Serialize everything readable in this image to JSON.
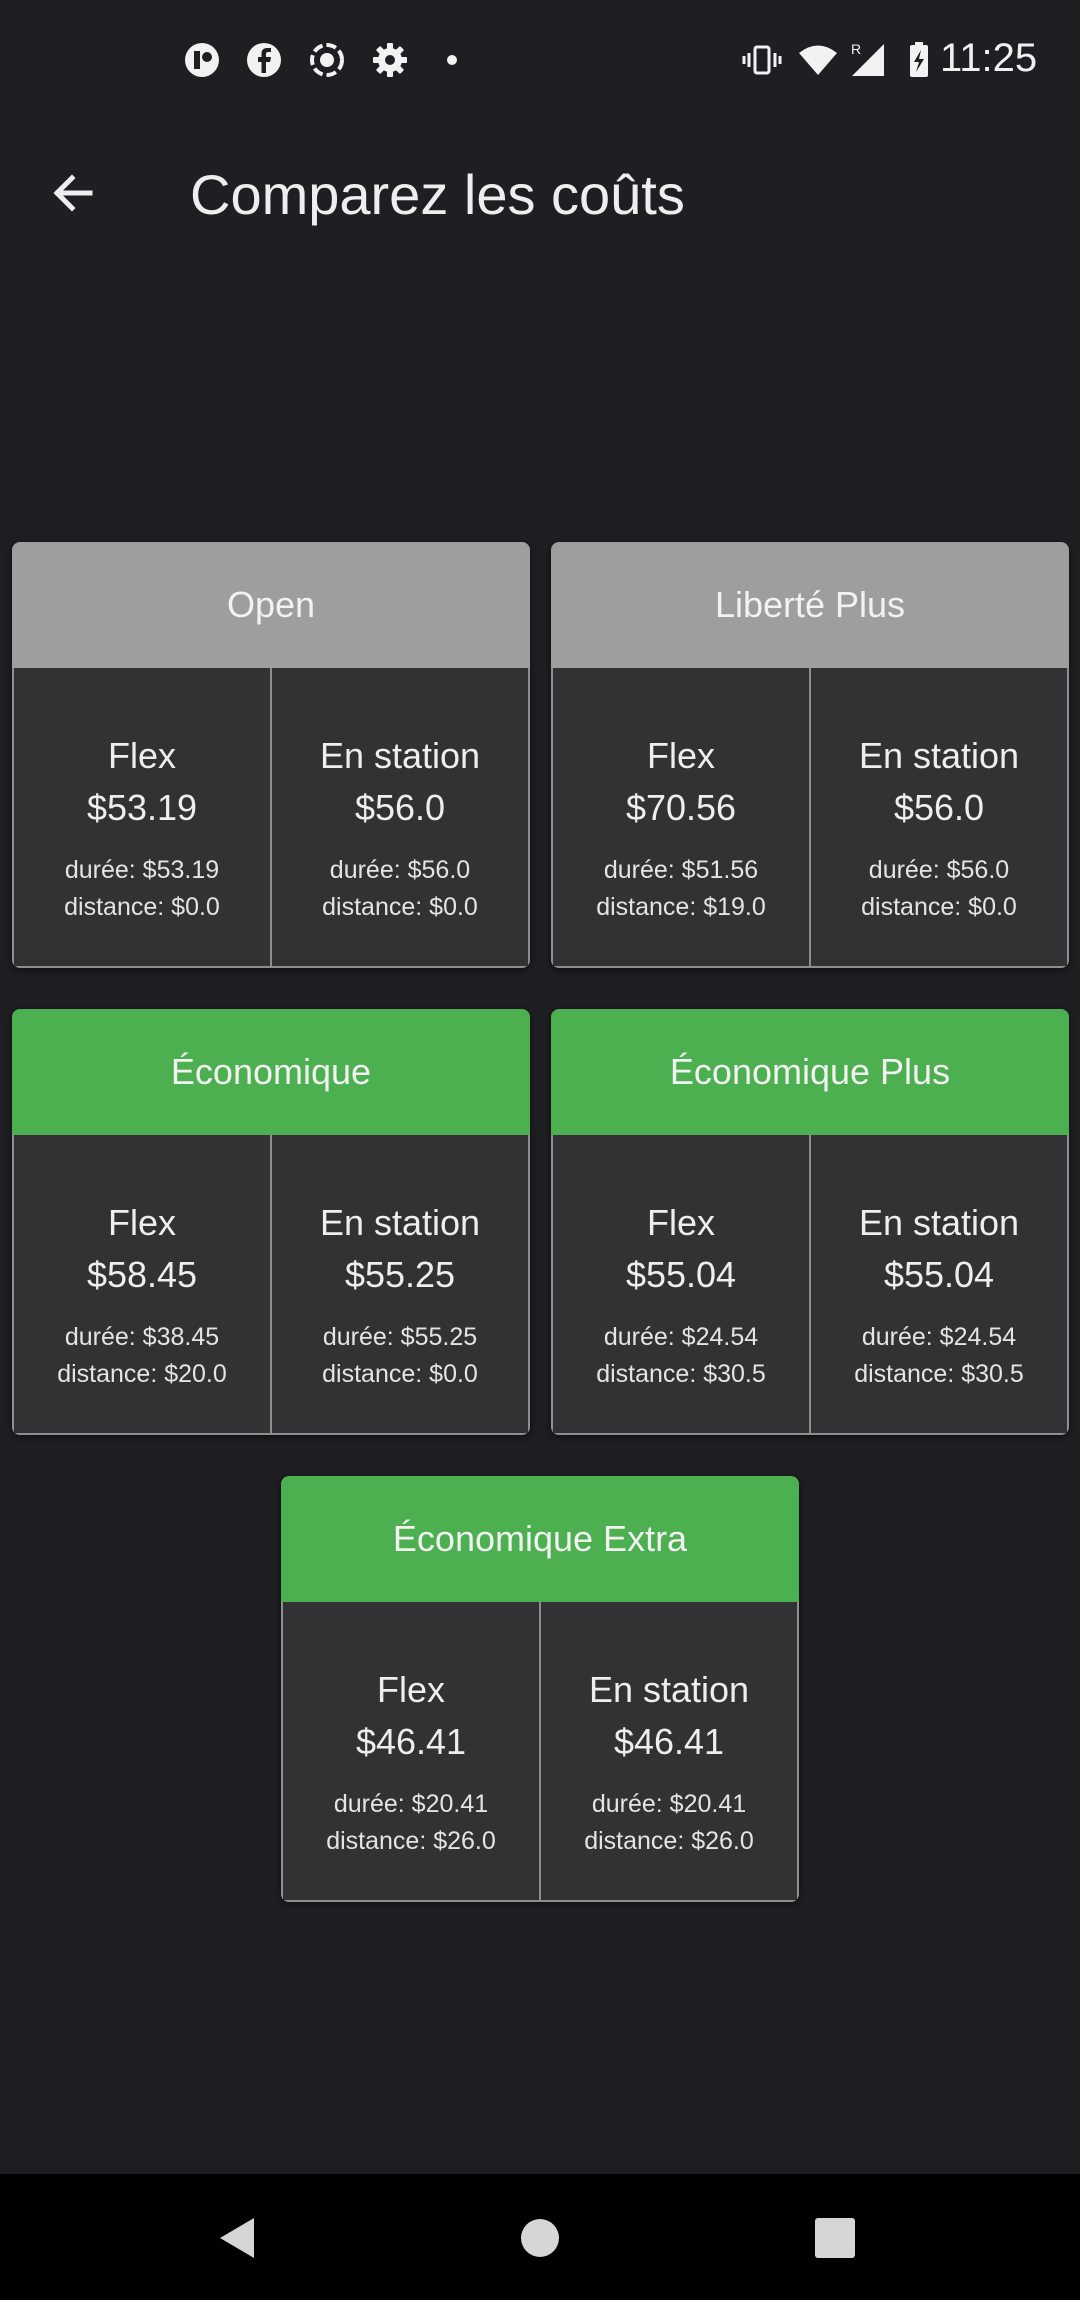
{
  "status_bar": {
    "time": "11:25",
    "left_icons": [
      "app-icon",
      "facebook-icon",
      "screen-record-icon",
      "settings-icon",
      "dot-icon"
    ],
    "right_icons": [
      "vibrate-icon",
      "wifi-icon",
      "signal-icon",
      "battery-charging-icon"
    ]
  },
  "app_bar": {
    "title": "Comparez les coûts",
    "back_icon": "arrow-left-icon"
  },
  "colors": {
    "background": "#1f1e23",
    "header_gray": "#9e9e9e",
    "header_green": "#4caf50",
    "cell_background": "#323134"
  },
  "plans": [
    {
      "name": "Open",
      "header_color": "gray",
      "options": [
        {
          "label": "Flex",
          "price": "$53.19",
          "duree": "durée: $53.19",
          "distance": "distance: $0.0"
        },
        {
          "label": "En station",
          "price": "$56.0",
          "duree": "durée: $56.0",
          "distance": "distance: $0.0"
        }
      ]
    },
    {
      "name": "Liberté Plus",
      "header_color": "gray",
      "options": [
        {
          "label": "Flex",
          "price": "$70.56",
          "duree": "durée: $51.56",
          "distance": "distance: $19.0"
        },
        {
          "label": "En station",
          "price": "$56.0",
          "duree": "durée: $56.0",
          "distance": "distance: $0.0"
        }
      ]
    },
    {
      "name": "Économique",
      "header_color": "green",
      "options": [
        {
          "label": "Flex",
          "price": "$58.45",
          "duree": "durée: $38.45",
          "distance": "distance: $20.0"
        },
        {
          "label": "En station",
          "price": "$55.25",
          "duree": "durée: $55.25",
          "distance": "distance: $0.0"
        }
      ]
    },
    {
      "name": "Économique Plus",
      "header_color": "green",
      "options": [
        {
          "label": "Flex",
          "price": "$55.04",
          "duree": "durée: $24.54",
          "distance": "distance: $30.5"
        },
        {
          "label": "En station",
          "price": "$55.04",
          "duree": "durée: $24.54",
          "distance": "distance: $30.5"
        }
      ]
    },
    {
      "name": "Économique Extra",
      "header_color": "green",
      "options": [
        {
          "label": "Flex",
          "price": "$46.41",
          "duree": "durée: $20.41",
          "distance": "distance: $26.0"
        },
        {
          "label": "En station",
          "price": "$46.41",
          "duree": "durée: $20.41",
          "distance": "distance: $26.0"
        }
      ]
    }
  ],
  "nav_bar": {
    "icons": [
      "back-triangle-icon",
      "home-circle-icon",
      "recents-square-icon"
    ]
  }
}
